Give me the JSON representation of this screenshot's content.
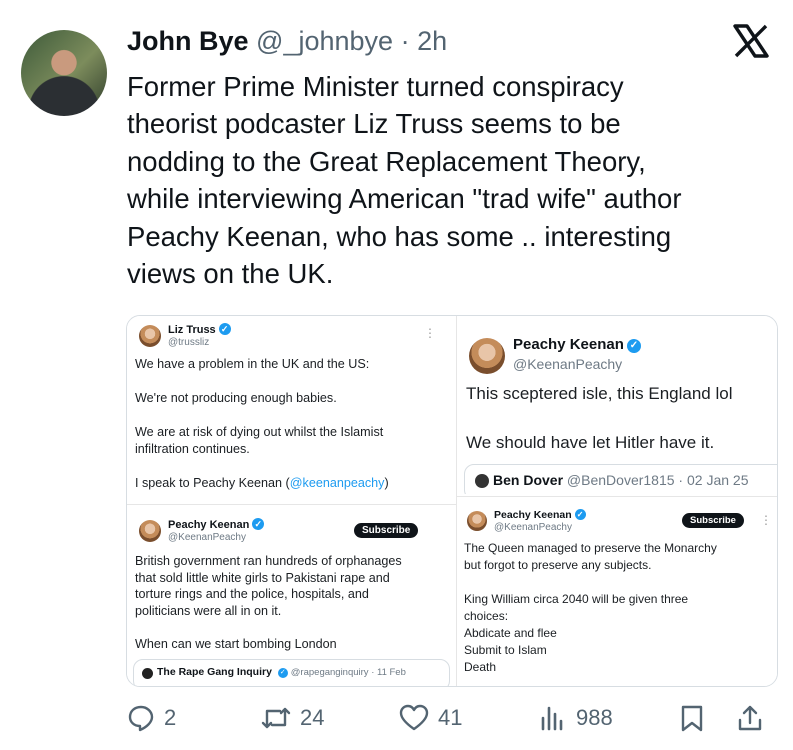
{
  "tweet": {
    "author_name": "John Bye",
    "author_handle": "@_johnbye",
    "separator": " · ",
    "time": "2h",
    "text_lines": [
      "Former Prime Minister turned conspiracy",
      "theorist podcaster Liz Truss seems to be",
      "nodding to the Great Replacement Theory,",
      "while interviewing American \"trad wife\" author",
      "Peachy Keenan, who has some .. interesting",
      "views on the UK."
    ]
  },
  "screenshots": {
    "truss": {
      "name": "Liz Truss",
      "handle": "@trussliz",
      "p1": "We have a problem in the UK and the US:",
      "p2": "We're not producing enough babies.",
      "p3a": "We are at risk of dying out whilst the Islamist",
      "p3b": "infiltration continues.",
      "p4": "I speak to Peachy Keenan (",
      "p4_link": "@keenanpeachy",
      "p4_end": ")"
    },
    "keenan1": {
      "name": "Peachy Keenan",
      "handle": "@KeenanPeachy",
      "line1": "This sceptered isle, this England lol",
      "line2": "We should have let Hitler have it.",
      "quote_name": "Ben Dover",
      "quote_handle": "@BenDover1815",
      "quote_date": " · 02 Jan 25"
    },
    "keenan2": {
      "name": "Peachy Keenan",
      "handle": "@KeenanPeachy",
      "subscribe": "Subscribe",
      "l1": "British government ran hundreds of orphanages",
      "l2": "that sold little white girls to Pakistani rape and",
      "l3": "torture rings and the police, hospitals, and",
      "l4": "politicians were all in on it.",
      "l5": "When can we start bombing London",
      "quote_name": "The Rape Gang Inquiry",
      "quote_handle": "@rapeganginquiry",
      "quote_date": " · 11 Feb"
    },
    "keenan3": {
      "name": "Peachy Keenan",
      "handle": "@KeenanPeachy",
      "subscribe": "Subscribe",
      "l1": "The Queen managed to preserve the Monarchy",
      "l2": "but forgot to preserve any subjects.",
      "l3": "King William circa 2040 will be given three",
      "l4": "choices:",
      "l5": "Abdicate and flee",
      "l6": "Submit to Islam",
      "l7": "Death"
    }
  },
  "actions": {
    "replies": "2",
    "reposts": "24",
    "likes": "41",
    "views": "988"
  },
  "colors": {
    "accent": "#1d9bf0",
    "muted": "#536471",
    "text": "#0f1419"
  },
  "icons": [
    "x-logo-icon",
    "verified-icon",
    "reply-icon",
    "repost-icon",
    "like-icon",
    "views-icon",
    "bookmark-icon",
    "share-icon"
  ]
}
